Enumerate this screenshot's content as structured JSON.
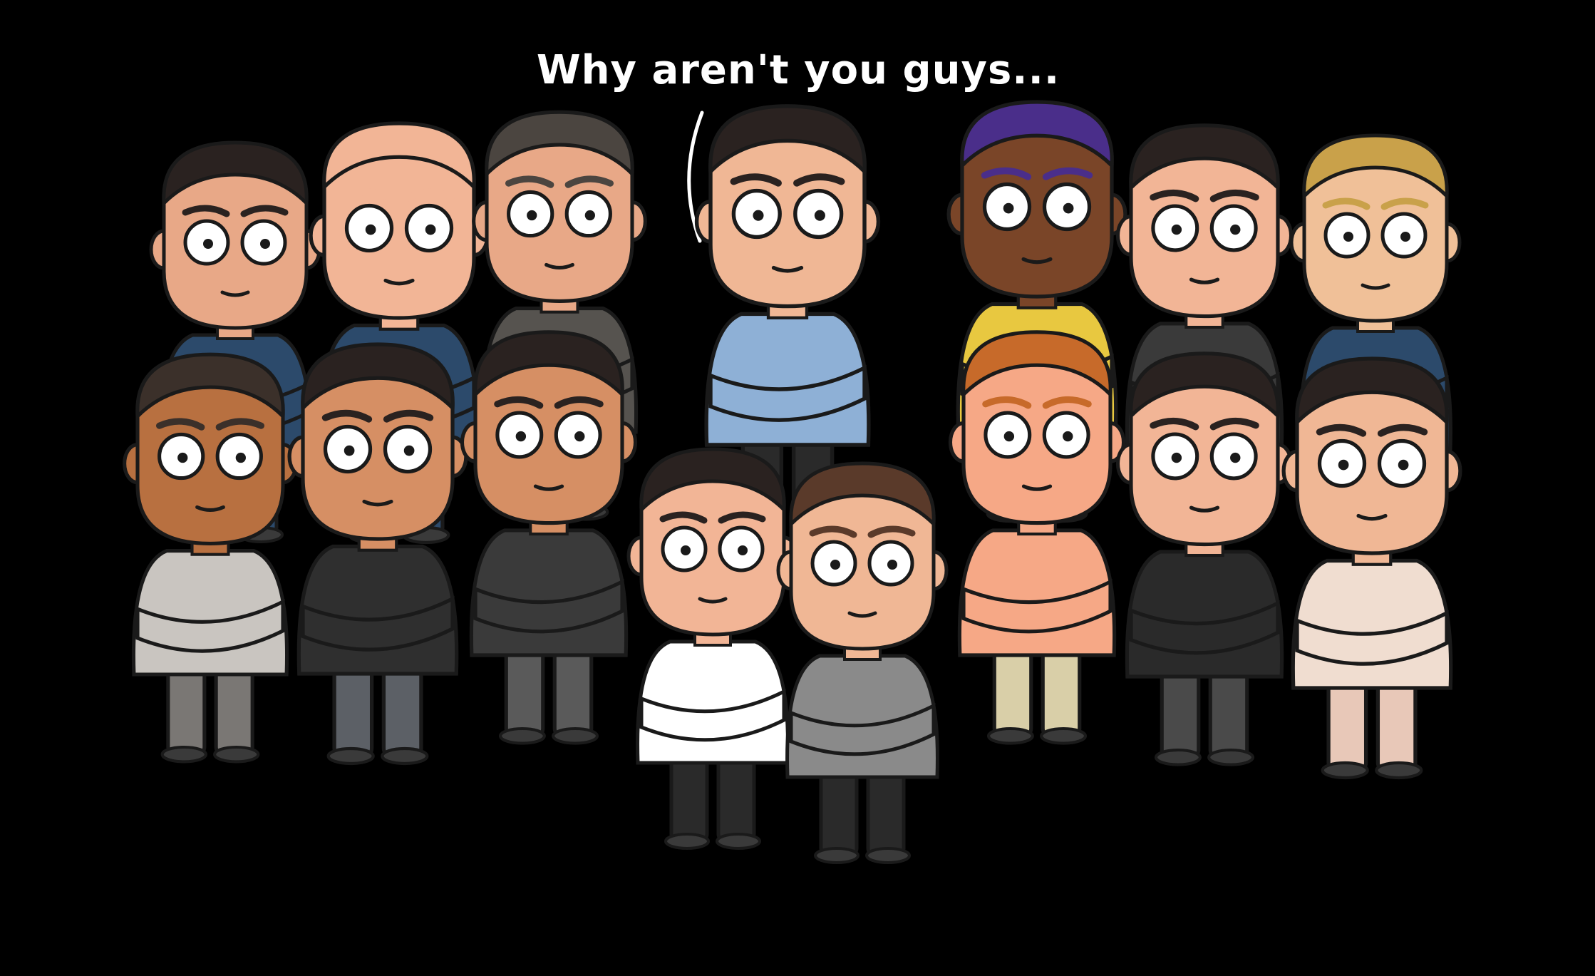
{
  "speech": {
    "text": "Why aren't you guys..."
  },
  "palette": {
    "background": "#000000",
    "outline": "#1a1a1a",
    "text": "#ffffff"
  },
  "characters": [
    {
      "name": "glasses-goatee-man",
      "skin": "#e8a887",
      "hair": "#2a2220",
      "shirt": "#2c4a6b",
      "pants": "#2c4a6b"
    },
    {
      "name": "bald-older-man",
      "skin": "#f2b596",
      "hair": "#f2b596",
      "shirt": "#2c4a6b",
      "pants": "#2c4a6b"
    },
    {
      "name": "grey-haired-man",
      "skin": "#e8a887",
      "hair": "#4b4540",
      "shirt": "#56534f",
      "pants": "#3d3b39"
    },
    {
      "name": "speaking-center-man",
      "skin": "#f0b795",
      "hair": "#2a2220",
      "shirt": "#8eb0d6",
      "pants": "#2a2a2a"
    },
    {
      "name": "purple-cap-man",
      "skin": "#7a4528",
      "hair": "#4a2e8a",
      "shirt": "#e8c840",
      "pants": "#2a2a2a"
    },
    {
      "name": "suit-man",
      "skin": "#f2b596",
      "hair": "#2a2220",
      "shirt": "#3a3a3a",
      "pants": "#3a3a3a"
    },
    {
      "name": "blond-man",
      "skin": "#f0c098",
      "hair": "#c9a14a",
      "shirt": "#2c4a6b",
      "pants": "#2c4a6b"
    },
    {
      "name": "tan-man-arms-crossed",
      "skin": "#b87040",
      "hair": "#3b302a",
      "shirt": "#c9c5c0",
      "pants": "#7a7774"
    },
    {
      "name": "bearded-man-black-shirt",
      "skin": "#d68f64",
      "hair": "#2a2220",
      "shirt": "#2f2f2f",
      "pants": "#5c6066"
    },
    {
      "name": "headphones-bearded-man",
      "skin": "#d68f64",
      "hair": "#2a2220",
      "shirt": "#3a3a3a",
      "pants": "#5a5a5a"
    },
    {
      "name": "crying-man-white-shirt",
      "skin": "#f2b596",
      "hair": "#2a2220",
      "shirt": "#ffffff",
      "pants": "#2a2a2a"
    },
    {
      "name": "crying-man-grey-hoodie",
      "skin": "#f0b795",
      "hair": "#5a3a2a",
      "shirt": "#8a8a8a",
      "pants": "#2a2a2a"
    },
    {
      "name": "shirtless-red-hair-man",
      "skin": "#f6a886",
      "hair": "#c76a2a",
      "shirt": "#f6a886",
      "pants": "#d9cfa8"
    },
    {
      "name": "smiling-man-dark-jacket",
      "skin": "#f2b596",
      "hair": "#2a2220",
      "shirt": "#2a2a2a",
      "pants": "#4a4a4a"
    },
    {
      "name": "bearded-man-beige",
      "skin": "#f0b795",
      "hair": "#2a2220",
      "shirt": "#f0ddd0",
      "pants": "#e8c8b8"
    }
  ]
}
